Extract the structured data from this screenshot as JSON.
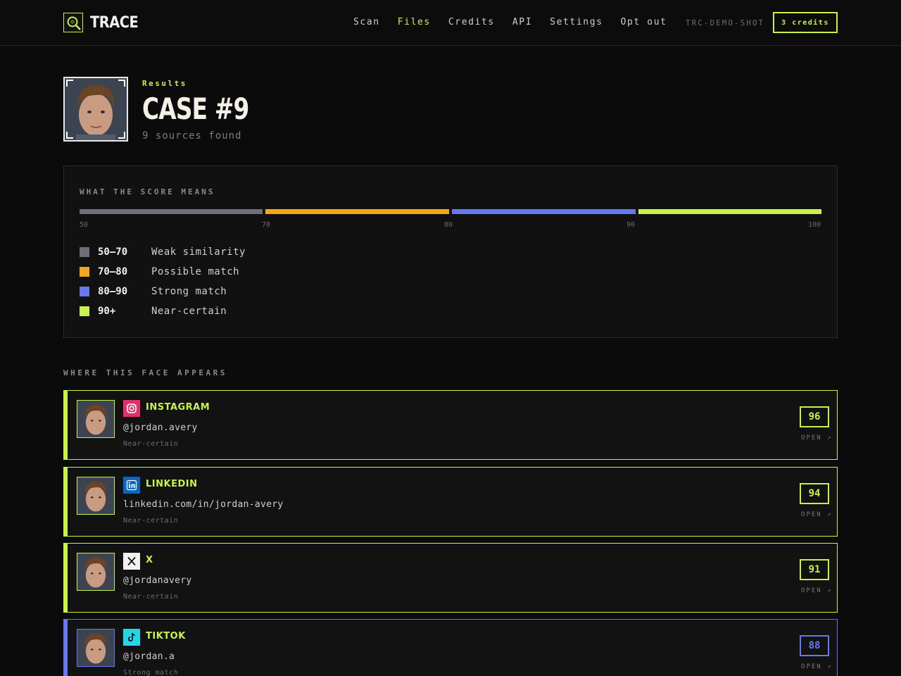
{
  "app": {
    "name": "TRACE",
    "session_id": "TRC-DEMO-SHOT",
    "credits_label": "3 credits"
  },
  "nav": {
    "items": [
      {
        "label": "Scan",
        "active": false
      },
      {
        "label": "Files",
        "active": true
      },
      {
        "label": "Credits",
        "active": false
      },
      {
        "label": "API",
        "active": false
      },
      {
        "label": "Settings",
        "active": false
      },
      {
        "label": "Opt out",
        "active": false
      }
    ]
  },
  "header": {
    "eyebrow": "Results",
    "title": "CASE #9",
    "subtitle": "9 sources found"
  },
  "legend": {
    "heading": "WHAT THE SCORE MEANS",
    "ticks": [
      "50",
      "70",
      "80",
      "90",
      "100"
    ],
    "bands": [
      {
        "range": "50–70",
        "label": "Weak similarity",
        "color": "#6e6f78"
      },
      {
        "range": "70–80",
        "label": "Possible match",
        "color": "#f2a818"
      },
      {
        "range": "80–90",
        "label": "Strong match",
        "color": "#6677f0"
      },
      {
        "range": "90+",
        "label": "Near-certain",
        "color": "#c8f24a"
      }
    ]
  },
  "results": {
    "heading": "WHERE THIS FACE APPEARS",
    "open_label": "OPEN ↗",
    "items": [
      {
        "platform": "INSTAGRAM",
        "icon": "instagram-icon",
        "handle": "@jordan.avery",
        "verdict": "Near-certain",
        "score": "96",
        "color": "#c8f24a"
      },
      {
        "platform": "LINKEDIN",
        "icon": "linkedin-icon",
        "handle": "linkedin.com/in/jordan-avery",
        "verdict": "Near-certain",
        "score": "94",
        "color": "#c8f24a"
      },
      {
        "platform": "X",
        "icon": "x-icon",
        "handle": "@jordanavery",
        "verdict": "Near-certain",
        "score": "91",
        "color": "#c8f24a"
      },
      {
        "platform": "TIKTOK",
        "icon": "tiktok-icon",
        "handle": "@jordan.a",
        "verdict": "Strong match",
        "score": "88",
        "color": "#6677f0"
      }
    ]
  }
}
